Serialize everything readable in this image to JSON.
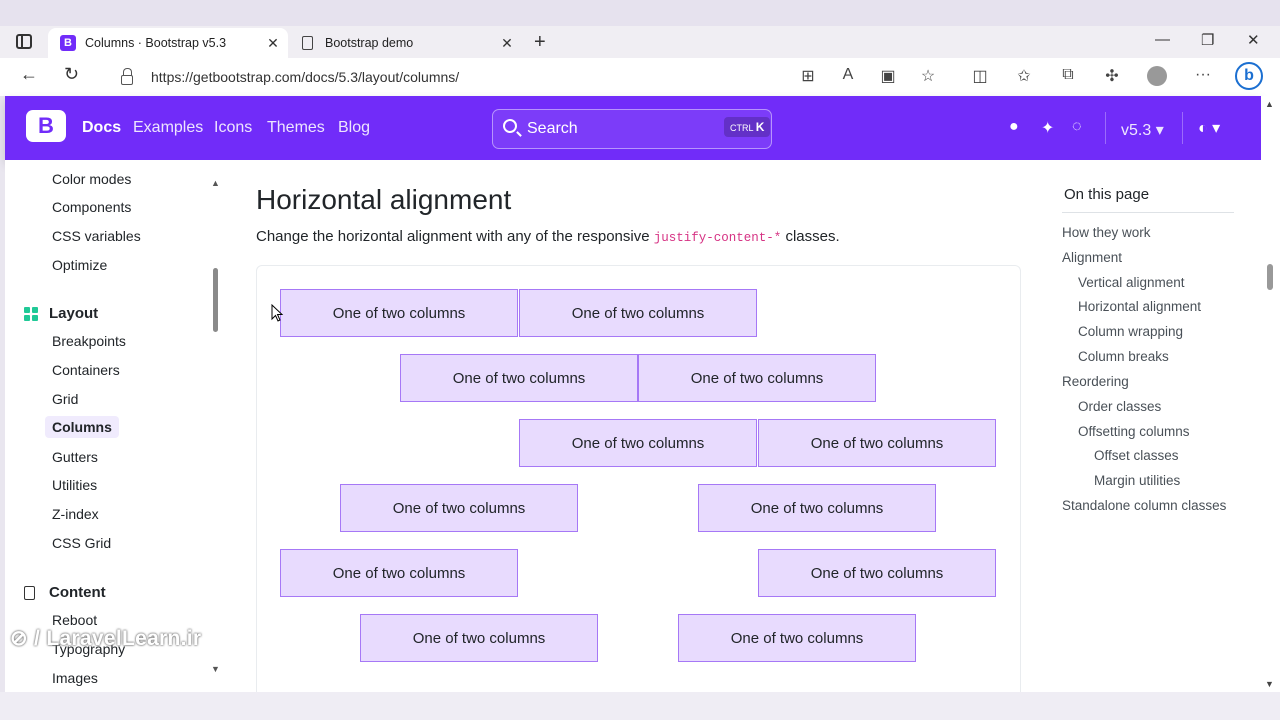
{
  "browser": {
    "tabs": [
      {
        "title": "Columns · Bootstrap v5.3"
      },
      {
        "title": "Bootstrap demo"
      }
    ],
    "url": "https://getbootstrap.com/docs/5.3/layout/columns/"
  },
  "navbar": {
    "brand": "B",
    "links": [
      "Docs",
      "Examples",
      "Icons",
      "Themes",
      "Blog"
    ],
    "search_placeholder": "Search",
    "search_shortcut_mod": "CTRL",
    "search_shortcut_key": "K",
    "version": "v5.3"
  },
  "sidebar": {
    "items_top": [
      "Color modes",
      "Components",
      "CSS variables",
      "Optimize"
    ],
    "layout_heading": "Layout",
    "layout_items": [
      "Breakpoints",
      "Containers",
      "Grid",
      "Columns",
      "Gutters",
      "Utilities",
      "Z-index",
      "CSS Grid"
    ],
    "active_item": "Columns",
    "content_heading": "Content",
    "content_items": [
      "Reboot",
      "Typography",
      "Images"
    ]
  },
  "main": {
    "heading": "Horizontal alignment",
    "lead_before": "Change the horizontal alignment with any of the responsive ",
    "lead_code": "justify-content-*",
    "lead_after": " classes.",
    "column_label": "One of two columns"
  },
  "toc": {
    "heading": "On this page",
    "items": [
      {
        "label": "How they work",
        "level": 1
      },
      {
        "label": "Alignment",
        "level": 1
      },
      {
        "label": "Vertical alignment",
        "level": 2
      },
      {
        "label": "Horizontal alignment",
        "level": 2
      },
      {
        "label": "Column wrapping",
        "level": 2
      },
      {
        "label": "Column breaks",
        "level": 2
      },
      {
        "label": "Reordering",
        "level": 1
      },
      {
        "label": "Order classes",
        "level": 2
      },
      {
        "label": "Offsetting columns",
        "level": 2
      },
      {
        "label": "Offset classes",
        "level": 3
      },
      {
        "label": "Margin utilities",
        "level": 3
      },
      {
        "label": "Standalone column classes",
        "level": 1
      }
    ]
  },
  "watermark": "LaravelLearn.ir",
  "colors": {
    "brand": "#712cf9",
    "column_bg": "#e8dbfe",
    "column_border": "#a678f6"
  }
}
